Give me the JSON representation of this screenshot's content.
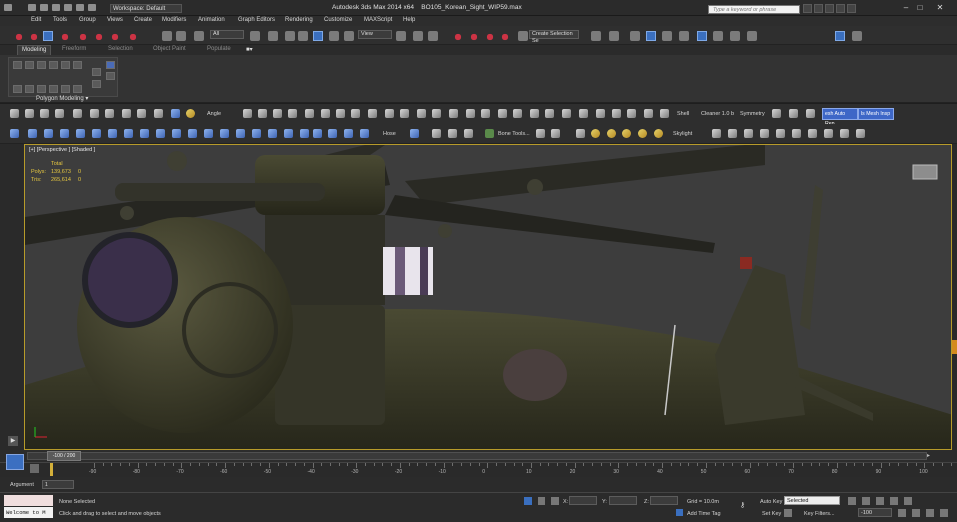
{
  "window": {
    "title": "Autodesk 3ds Max  2014 x64",
    "file": "BO105_Korean_Sight_WIP59.max",
    "workspace": "Workspace: Default",
    "search_placeholder": "Type a keyword or phrase"
  },
  "menu": [
    "Edit",
    "Tools",
    "Group",
    "Views",
    "Create",
    "Modifiers",
    "Animation",
    "Graph Editors",
    "Rendering",
    "Customize",
    "MAXScript",
    "Help"
  ],
  "toolbar": {
    "filter_value": "All",
    "view_value": "View",
    "selection_set_placeholder": "Create Selection Se"
  },
  "ribbon": {
    "tabs": [
      "Modeling",
      "Freeform",
      "Selection",
      "Object Paint",
      "Populate"
    ],
    "active_tab": "Modeling",
    "panel_label": "Polygon Modeling ▾"
  },
  "toolbar2": {
    "angle_label": "Angle",
    "shell_label": "Shell",
    "cleaner_label": "Cleaner 1.0 b",
    "symmetry_label": "Symmetry",
    "btn1": "esh Auto Rep",
    "btn2": "ls Mesh Insp"
  },
  "toolbar3": {
    "hose_label": "Hose",
    "bone_label": "Bone Tools...",
    "skylight_label": "Skylight"
  },
  "viewport": {
    "label": "[+] [Perspective ] [Shaded ]",
    "stats_total": "Total",
    "polys_label": "Polys:",
    "polys_value": "139,673",
    "polys_sel": "0",
    "tris_label": "Tris:",
    "tris_value": "265,614",
    "tris_sel": "0"
  },
  "timeline": {
    "slider_label": "-100 / 200",
    "ticks": [
      "-90",
      "-80",
      "-70",
      "-60",
      "-50",
      "-40",
      "-30",
      "-20",
      "-10",
      "0",
      "10",
      "20",
      "30",
      "40",
      "50",
      "60",
      "70",
      "80",
      "90",
      "100"
    ]
  },
  "status": {
    "argument_label": "Argument",
    "argument_value": "1",
    "listener_text": "Welcome to M",
    "selection_text": "None Selected",
    "prompt_text": "Click and drag to select and move objects",
    "x_label": "X:",
    "y_label": "Y:",
    "z_label": "Z:",
    "grid_text": "Grid = 10.0m",
    "add_time_tag": "Add Time Tag",
    "auto_key": "Auto Key",
    "set_key": "Set Key",
    "selected_value": "Selected",
    "key_filters": "Key Filters...",
    "frame_value": "-100"
  },
  "colors": {
    "viewport_border": "#b79b2a",
    "active_blue": "#3a6fbf",
    "stats_yellow": "#e6c740"
  }
}
